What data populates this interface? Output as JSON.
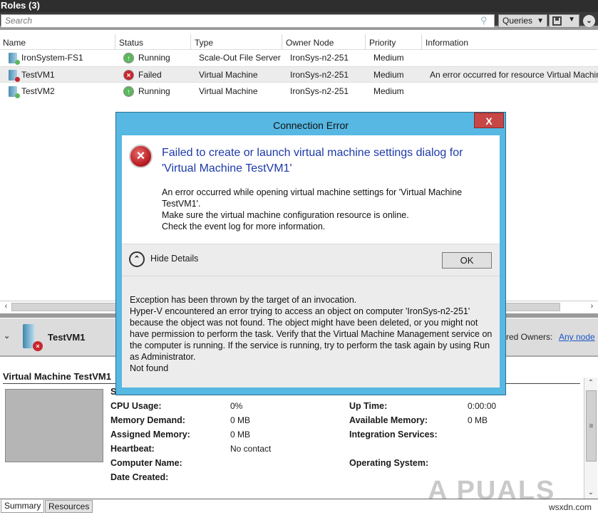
{
  "header": {
    "title": "Roles (3)"
  },
  "toolbar": {
    "search_placeholder": "Search",
    "queries_label": "Queries",
    "dropdown_arrow": "▼",
    "expand_icon": "⌄"
  },
  "grid": {
    "columns": [
      "Name",
      "Status",
      "Type",
      "Owner Node",
      "Priority",
      "Information"
    ],
    "rows": [
      {
        "name": "IronSystem-FS1",
        "status": "Running",
        "type": "Scale-Out File Server",
        "owner": "IronSys-n2-251",
        "priority": "Medium",
        "info": ""
      },
      {
        "name": "TestVM1",
        "status": "Failed",
        "type": "Virtual Machine",
        "owner": "IronSys-n2-251",
        "priority": "Medium",
        "info": "An error occurred for resource Virtual Machine"
      },
      {
        "name": "TestVM2",
        "status": "Running",
        "type": "Virtual Machine",
        "owner": "IronSys-n2-251",
        "priority": "Medium",
        "info": ""
      }
    ]
  },
  "details_panel": {
    "vm_name": "TestVM1",
    "preferred_owners_label": "rred Owners:",
    "preferred_owners_value": "Any node",
    "section_title": "Virtual Machine TestVM1",
    "status_label_partial": "S",
    "left_props": [
      {
        "label": "CPU Usage:",
        "value": "0%"
      },
      {
        "label": "Memory Demand:",
        "value": "0 MB"
      },
      {
        "label": "Assigned Memory:",
        "value": "0 MB"
      },
      {
        "label": "Heartbeat:",
        "value": "No contact"
      },
      {
        "label": "Computer Name:",
        "value": ""
      },
      {
        "label": "Date Created:",
        "value": ""
      }
    ],
    "right_props": [
      {
        "label": "Up Time:",
        "value": "0:00:00"
      },
      {
        "label": "Available Memory:",
        "value": "0 MB"
      },
      {
        "label": "Integration Services:",
        "value": ""
      },
      {
        "label": "Operating System:",
        "value": ""
      }
    ],
    "tabs": [
      "Summary",
      "Resources"
    ],
    "active_tab": "Summary"
  },
  "dialog": {
    "title": "Connection Error",
    "close_label": "X",
    "heading": "Failed to create or launch virtual machine settings dialog for 'Virtual Machine TestVM1'",
    "message_lines": [
      "An error occurred while opening virtual machine settings for 'Virtual Machine TestVM1'.",
      "Make sure the virtual machine configuration resource is online.",
      "Check the event log for more information."
    ],
    "hide_details_label": "Hide Details",
    "ok_label": "OK",
    "details_lines": [
      "Exception has been thrown by the target of an invocation.",
      "Hyper-V encountered an error trying to access an object on computer 'IronSys-n2-251' because the object was not found. The object might have been deleted, or you might not have permission to perform the task. Verify that the Virtual Machine Management service on the computer is running. If the service is running, try to perform the task again by using Run as Administrator.",
      "Not found"
    ]
  },
  "watermark": {
    "brand": "A PUALS",
    "site": "wsxdn.com"
  },
  "colors": {
    "accent": "#56b8e3",
    "error": "#c8262f",
    "running": "#5cb85c",
    "heading_blue": "#1d3aa8",
    "link": "#1a55c8"
  }
}
